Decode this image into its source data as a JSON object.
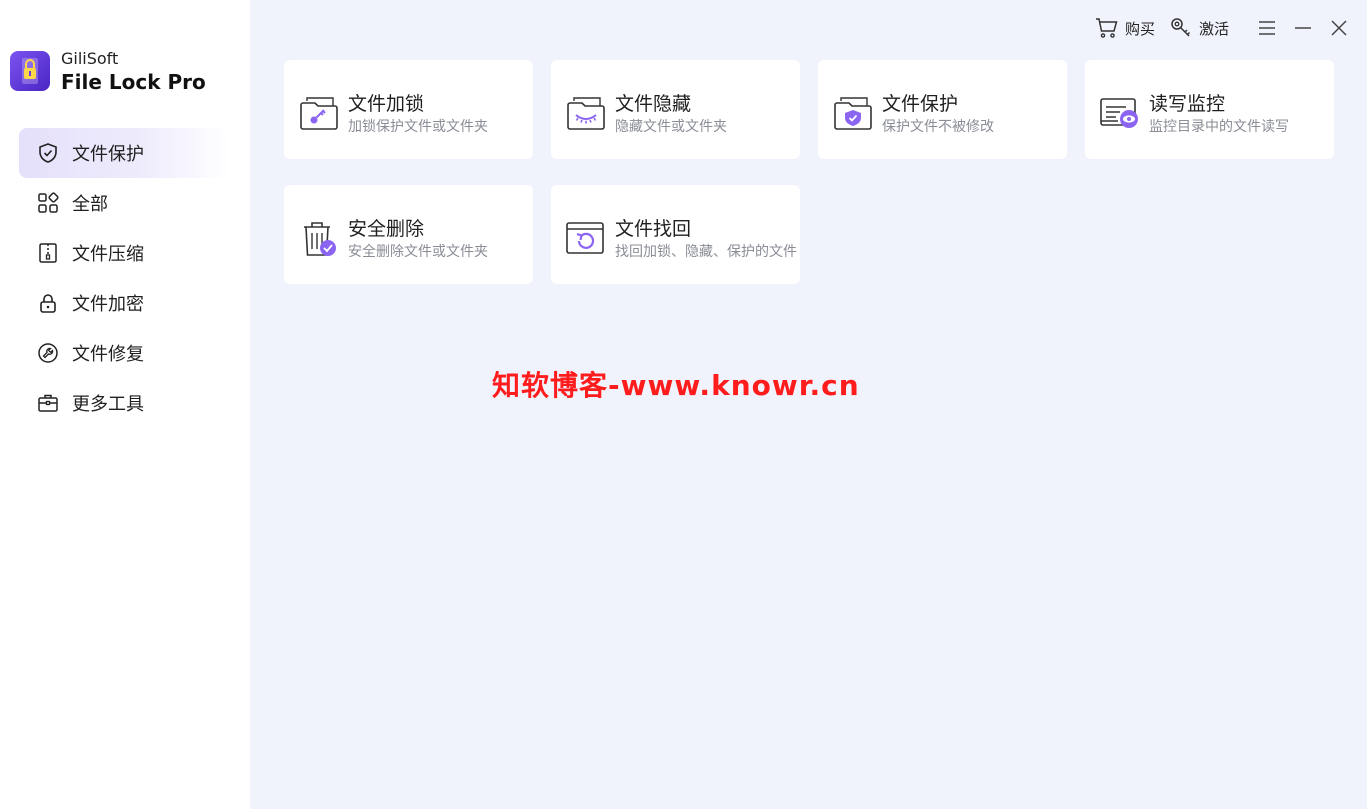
{
  "brand": {
    "company": "GiliSoft",
    "product": "File Lock Pro"
  },
  "topbar": {
    "buy_label": "购买",
    "activate_label": "激活"
  },
  "sidebar": {
    "items": [
      {
        "label": "文件保护",
        "icon": "shield-icon",
        "active": true
      },
      {
        "label": "全部",
        "icon": "grid-icon"
      },
      {
        "label": "文件压缩",
        "icon": "zip-icon"
      },
      {
        "label": "文件加密",
        "icon": "lock-icon"
      },
      {
        "label": "文件修复",
        "icon": "wrench-icon"
      },
      {
        "label": "更多工具",
        "icon": "toolbox-icon"
      }
    ]
  },
  "cards": [
    {
      "title": "文件加锁",
      "desc": "加锁保护文件或文件夹",
      "icon": "folder-key-icon"
    },
    {
      "title": "文件隐藏",
      "desc": "隐藏文件或文件夹",
      "icon": "folder-hidden-icon"
    },
    {
      "title": "文件保护",
      "desc": "保护文件不被修改",
      "icon": "folder-shield-icon"
    },
    {
      "title": "读写监控",
      "desc": "监控目录中的文件读写",
      "icon": "monitor-eye-icon"
    },
    {
      "title": "安全删除",
      "desc": "安全删除文件或文件夹",
      "icon": "trash-check-icon"
    },
    {
      "title": "文件找回",
      "desc": "找回加锁、隐藏、保护的文件",
      "icon": "window-restore-icon"
    }
  ],
  "watermark": "知软博客-www.knowr.cn",
  "colors": {
    "accent": "#7b53f0",
    "background": "#f1f3fc",
    "watermark": "#ff1c1c"
  }
}
